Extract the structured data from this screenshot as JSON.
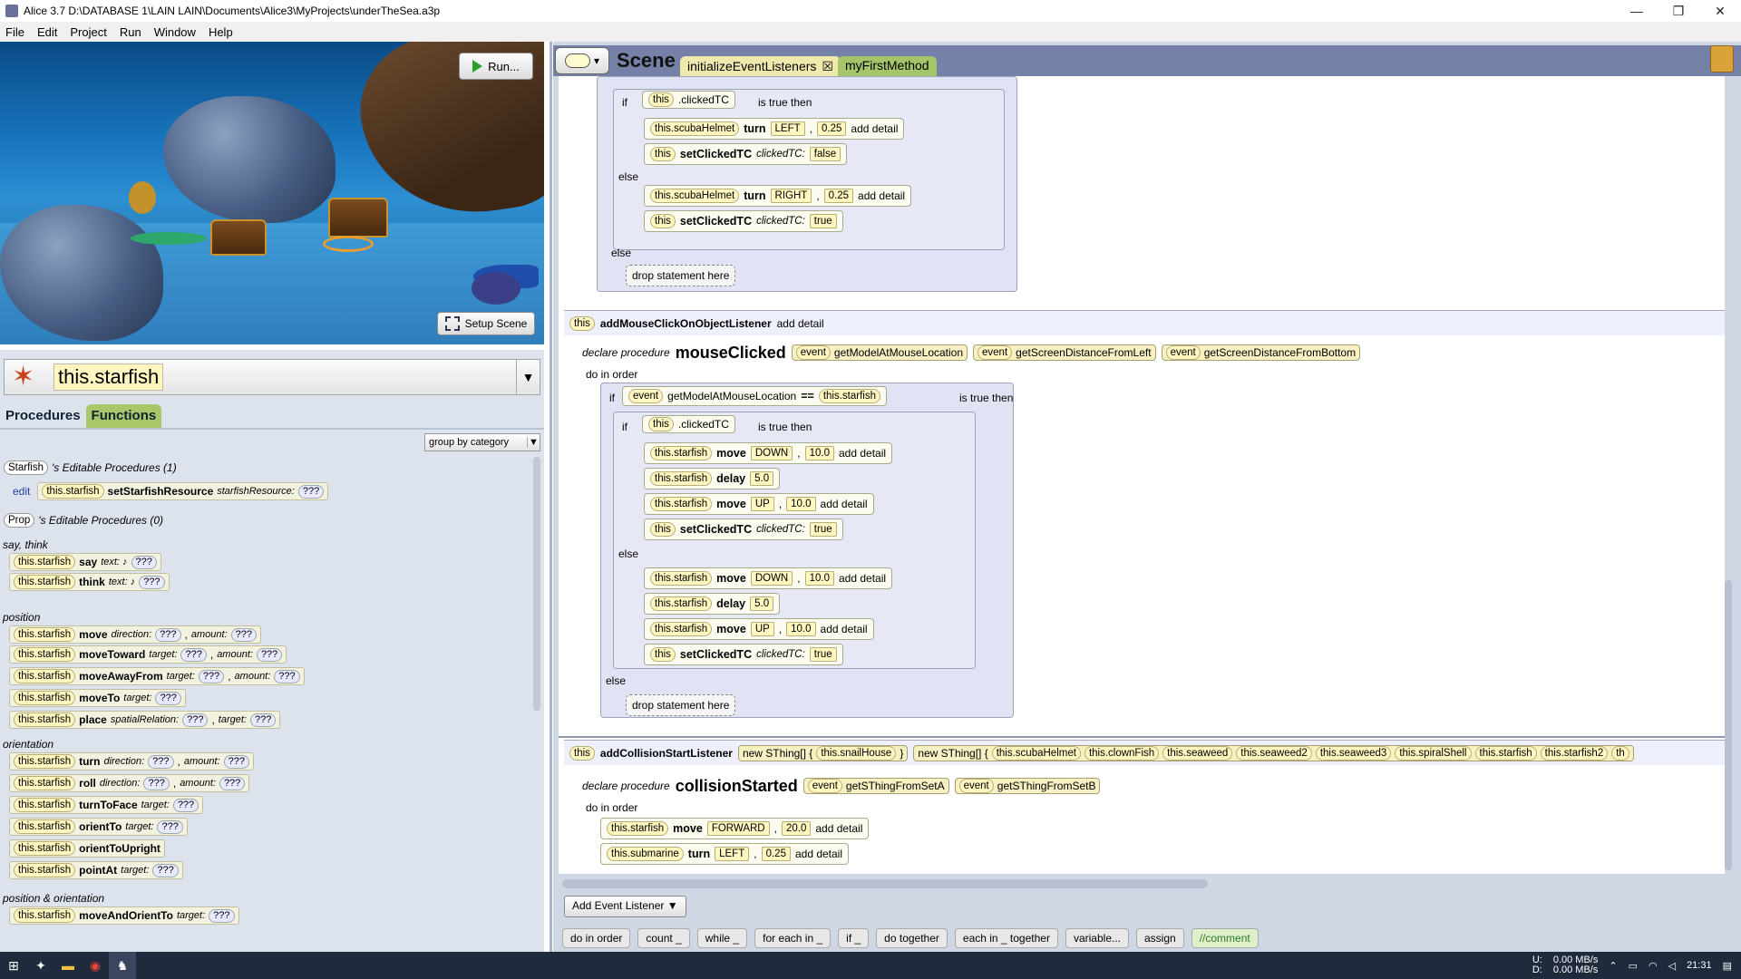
{
  "window": {
    "title": "Alice 3.7 D:\\DATABASE 1\\LAIN LAIN\\Documents\\Alice3\\MyProjects\\underTheSea.a3p",
    "minimize": "—",
    "maximize": "❒",
    "close": "✕"
  },
  "menu": [
    "File",
    "Edit",
    "Project",
    "Run",
    "Window",
    "Help"
  ],
  "scene_view": {
    "run_label": "Run...",
    "setup_label": "Setup Scene"
  },
  "object_selector": {
    "value": "this.starfish"
  },
  "proc_tabs": {
    "procedures": "Procedures",
    "functions": "Functions"
  },
  "group_by": "group by category",
  "editable": {
    "class1": "Starfish",
    "class1_suffix": "'s Editable Procedures (1)",
    "edit": "edit",
    "proc1_target": "this.starfish",
    "proc1_name": "setStarfishResource",
    "proc1_param": "starfishResource:",
    "class2": "Prop",
    "class2_suffix": "'s Editable Procedures (0)"
  },
  "placeholder": "???",
  "categories": [
    {
      "name": "say, think",
      "items": [
        {
          "method": "say",
          "params": [
            "text: ♪"
          ]
        },
        {
          "method": "think",
          "params": [
            "text: ♪"
          ]
        }
      ]
    },
    {
      "name": "position",
      "items": [
        {
          "method": "move",
          "params": [
            "direction:",
            "amount:"
          ]
        },
        {
          "method": "moveToward",
          "params": [
            "target:",
            "amount:"
          ]
        },
        {
          "method": "moveAwayFrom",
          "params": [
            "target:",
            "amount:"
          ]
        },
        {
          "method": "moveTo",
          "params": [
            "target:"
          ]
        },
        {
          "method": "place",
          "params": [
            "spatialRelation:",
            "target:"
          ]
        }
      ]
    },
    {
      "name": "orientation",
      "items": [
        {
          "method": "turn",
          "params": [
            "direction:",
            "amount:"
          ]
        },
        {
          "method": "roll",
          "params": [
            "direction:",
            "amount:"
          ]
        },
        {
          "method": "turnToFace",
          "params": [
            "target:"
          ]
        },
        {
          "method": "orientTo",
          "params": [
            "target:"
          ]
        },
        {
          "method": "orientToUpright",
          "params": []
        },
        {
          "method": "pointAt",
          "params": [
            "target:"
          ]
        }
      ]
    },
    {
      "name": "position & orientation",
      "items": [
        {
          "method": "moveAndOrientTo",
          "params": [
            "target:"
          ]
        }
      ]
    }
  ],
  "proc_target": "this.starfish",
  "editor_tabs": {
    "scene": "Scene",
    "init": "initializeEventListeners",
    "init_close": "☒",
    "first": "myFirstMethod"
  },
  "code": {
    "block1": {
      "if1": "if",
      "this": "this",
      "clickedTC": ".clickedTC",
      "is_true_then": "is true then",
      "helmet": "this.scubaHelmet",
      "turn": "turn",
      "left": "LEFT",
      "right": "RIGHT",
      "amt025": "0.25",
      "add_detail": "add detail",
      "setClicked": "setClickedTC",
      "clickedTC_param": "clickedTC:",
      "false": "false",
      "true": "true",
      "else": "else",
      "drop": "drop statement here"
    },
    "listener1": {
      "this": "this",
      "name": "addMouseClickOnObjectListener",
      "add_detail": "add detail"
    },
    "decl1": {
      "declare": "declare procedure",
      "name": "mouseClicked",
      "event": "event",
      "e1": "getModelAtMouseLocation",
      "e2": "getScreenDistanceFromLeft",
      "e3": "getScreenDistanceFromBottom",
      "do_in_order": "do in order"
    },
    "block2": {
      "if": "if",
      "event": "event",
      "get": "getModelAtMouseLocation",
      "eq": "==",
      "target": "this.starfish",
      "is_true_then": "is true then",
      "starfish": "this.starfish",
      "move": "move",
      "down": "DOWN",
      "up": "UP",
      "amt10": "10.0",
      "delay": "delay",
      "amt5": "5.0",
      "this": "this",
      "clickedTC": ".clickedTC",
      "setClicked": "setClickedTC",
      "clickedTC_param": "clickedTC:",
      "true": "true",
      "add_detail": "add detail",
      "else": "else",
      "drop": "drop statement here"
    },
    "listener2": {
      "this": "this",
      "name": "addCollisionStartListener",
      "setA_prefix": "new SThing[] {",
      "setA": [
        "this.snailHouse"
      ],
      "setA_suffix": "}",
      "setB_prefix": "new SThing[] {",
      "setB": [
        "this.scubaHelmet",
        "this.clownFish",
        "this.seaweed",
        "this.seaweed2",
        "this.seaweed3",
        "this.spiralShell",
        "this.starfish",
        "this.starfish2",
        "th"
      ]
    },
    "decl2": {
      "declare": "declare procedure",
      "name": "collisionStarted",
      "event": "event",
      "e1": "getSThingFromSetA",
      "e2": "getSThingFromSetB",
      "do_in_order": "do in order"
    },
    "block3": {
      "starfish": "this.starfish",
      "move": "move",
      "forward": "FORWARD",
      "amt20": "20.0",
      "submarine": "this.submarine",
      "turn": "turn",
      "left": "LEFT",
      "amt025": "0.25",
      "add_detail": "add detail"
    }
  },
  "add_event_listener": "Add Event Listener ▼",
  "palette": [
    "do in order",
    "count _",
    "while _",
    "for each in _",
    "if _",
    "do together",
    "each in _ together",
    "variable...",
    "assign",
    "//comment"
  ],
  "taskbar": {
    "ud": "U:\nD:",
    "net_up": "0.00 MB/s",
    "net_down": "0.00 MB/s",
    "time": "21:31"
  }
}
